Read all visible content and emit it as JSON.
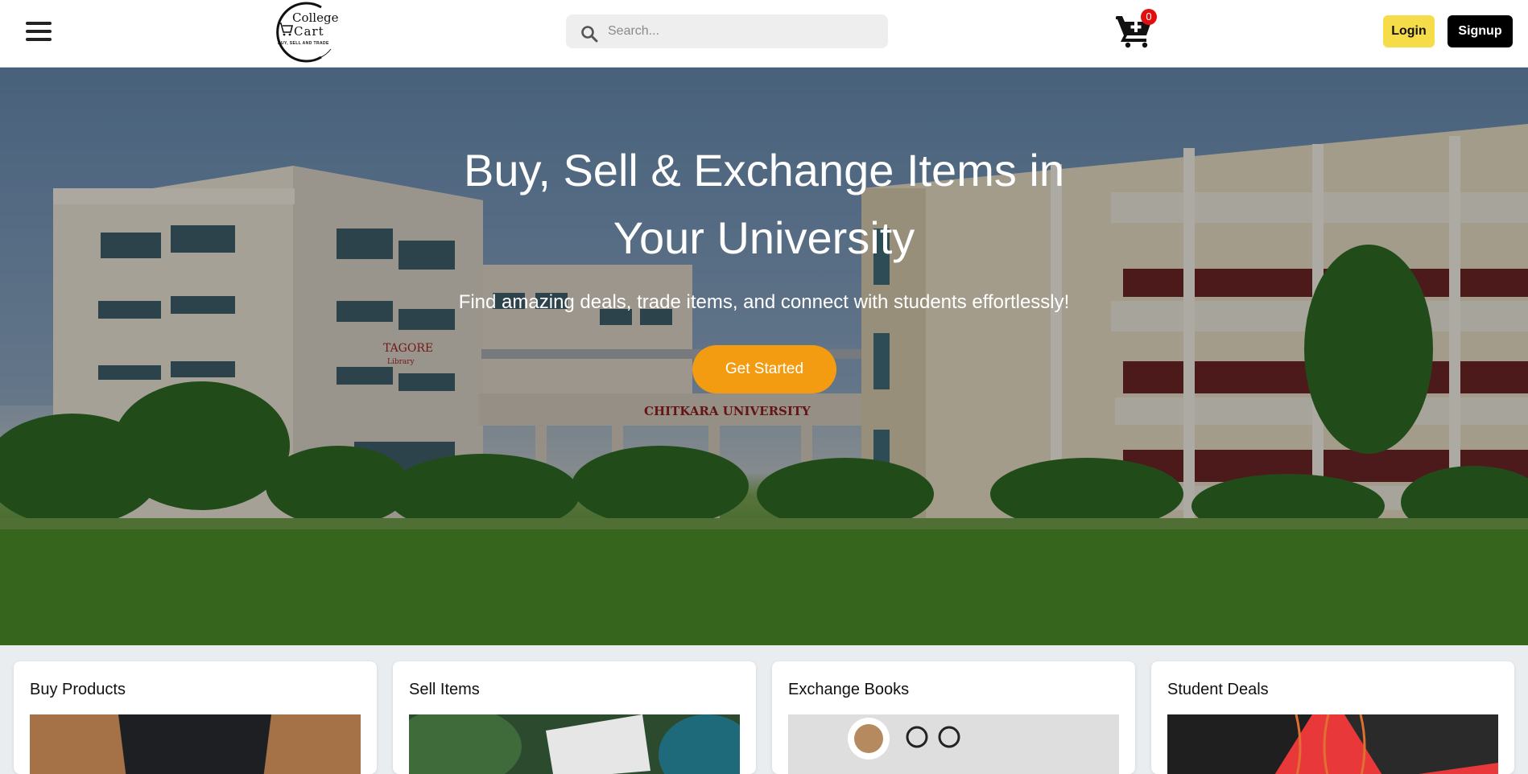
{
  "header": {
    "logo": {
      "line1": "College",
      "line2": "Cart",
      "tagline": "BUY, SELL AND TRADE"
    },
    "search": {
      "placeholder": "Search...",
      "value": ""
    },
    "cart": {
      "count": "0"
    },
    "login_label": "Login",
    "signup_label": "Signup",
    "icons": [
      "hamburger-menu-icon",
      "cart-icon",
      "search-icon"
    ]
  },
  "hero": {
    "title": "Buy, Sell & Exchange Items in Your University",
    "subtitle": "Find amazing deals, trade items, and connect with students effortlessly!",
    "cta_label": "Get Started",
    "photo_signs": {
      "library": "TAGORE Library",
      "gate": "CHITKARA UNIVERSITY"
    }
  },
  "cards": [
    {
      "title": "Buy Products"
    },
    {
      "title": "Sell Items"
    },
    {
      "title": "Exchange Books"
    },
    {
      "title": "Student Deals"
    }
  ],
  "colors": {
    "cta": "#f39c12",
    "login": "#f7dc4a",
    "signup": "#000000",
    "badge": "#e01010"
  }
}
